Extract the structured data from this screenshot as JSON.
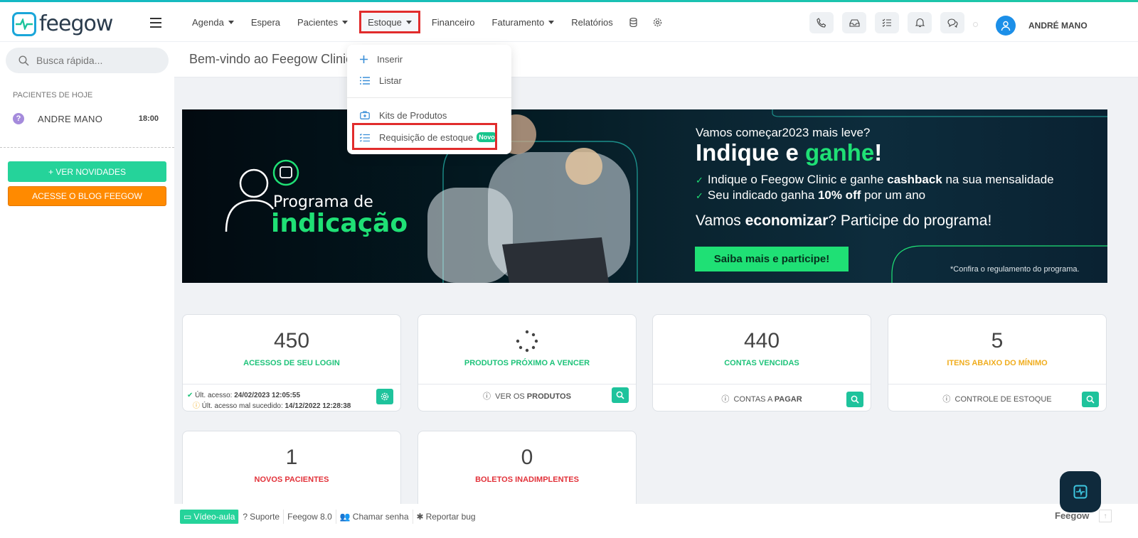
{
  "brand": {
    "name": "feegow",
    "accent": "#1aa6d9"
  },
  "nav": {
    "items": [
      {
        "label": "Agenda",
        "caret": true
      },
      {
        "label": "Espera",
        "caret": false
      },
      {
        "label": "Pacientes",
        "caret": true
      },
      {
        "label": "Estoque",
        "caret": true,
        "active": true
      },
      {
        "label": "Financeiro",
        "caret": false
      },
      {
        "label": "Faturamento",
        "caret": true
      },
      {
        "label": "Relatórios",
        "caret": false
      }
    ],
    "icons": [
      "database-icon",
      "gear-icon"
    ]
  },
  "top_tools": [
    "phone-icon",
    "inbox-icon",
    "checklist-icon",
    "bell-icon",
    "chat-icon"
  ],
  "user": {
    "name": "ANDRÉ MANO"
  },
  "sidebar": {
    "search_placeholder": "Busca rápida...",
    "section_title": "PACIENTES DE HOJE",
    "patients": [
      {
        "name": "ANDRE MANO",
        "time": "18:00"
      }
    ],
    "btn_news": "+ VER NOVIDADES",
    "btn_blog": "ACESSE O BLOG FEEGOW"
  },
  "page": {
    "title": "Bem-vindo ao Feegow Clinic"
  },
  "dropdown": {
    "items": [
      {
        "label": "Inserir",
        "icon": "plus-icon"
      },
      {
        "label": "Listar",
        "icon": "list-icon"
      },
      {
        "label": "Kits de Produtos",
        "icon": "kit-icon"
      },
      {
        "label": "Requisição de estoque",
        "icon": "checklist-icon",
        "badge": "Novo"
      }
    ]
  },
  "banner": {
    "program": "Programa de",
    "program_strong": "indicação",
    "headline_small": "Vamos começar2023 mais leve?",
    "headline_a": "Indique e ",
    "headline_b": "ganhe",
    "headline_c": "!",
    "bullet1_a": "Indique o Feegow Clinic e ganhe ",
    "bullet1_b": "cashback",
    "bullet1_c": " na sua mensalidade",
    "bullet2_a": "Seu indicado ganha ",
    "bullet2_b": "10% off",
    "bullet2_c": " por um ano",
    "cta_a": "Vamos ",
    "cta_b": "economizar",
    "cta_c": "? Participe do programa!",
    "button": "Saiba mais e participe!",
    "note": "*Confira o regulamento do programa."
  },
  "cards": [
    {
      "value": "450",
      "label": "ACESSOS DE SEU LOGIN",
      "color": "#1ec37a",
      "last_access_label": "Últ. acesso: ",
      "last_access": "24/02/2023 12:05:55",
      "last_fail_label": "Últ. acesso mal sucedido: ",
      "last_fail": "14/12/2022 12:28:38"
    },
    {
      "value": "",
      "label": "PRODUTOS PRÓXIMO A VENCER",
      "color": "#1ec37a",
      "foot_a": "VER OS ",
      "foot_b": "PRODUTOS"
    },
    {
      "value": "440",
      "label": "CONTAS VENCIDAS",
      "color": "#1ec37a",
      "foot_a": "CONTAS A ",
      "foot_b": "PAGAR"
    },
    {
      "value": "5",
      "label": "ITENS ABAIXO DO MÍNIMO",
      "color": "#f0ad1e",
      "foot_a": "CONTROLE DE ESTOQUE",
      "foot_b": ""
    },
    {
      "value": "1",
      "label": "NOVOS PACIENTES",
      "color": "#e2323a"
    },
    {
      "value": "0",
      "label": "BOLETOS INADIMPLENTES",
      "color": "#e2323a"
    }
  ],
  "bottom": {
    "video": "Vídeo-aula",
    "support": "Suporte",
    "version": "Feegow 8.0",
    "call": "Chamar senha",
    "bug": "Reportar bug",
    "right": "Feegow"
  }
}
